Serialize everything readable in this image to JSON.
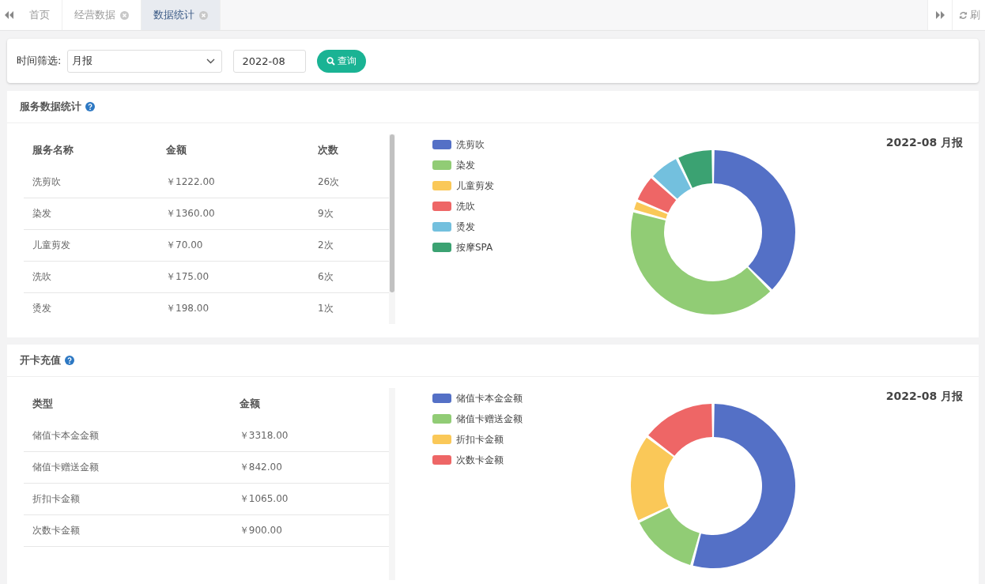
{
  "tabs": [
    {
      "label": "首页",
      "closable": false,
      "selected": false
    },
    {
      "label": "经营数据",
      "closable": true,
      "selected": false
    },
    {
      "label": "数据统计",
      "closable": true,
      "selected": true
    }
  ],
  "refresh_label": "刷",
  "filter": {
    "label": "时间筛选:",
    "period": "月报",
    "date": "2022-08",
    "button": "查询"
  },
  "panels": [
    {
      "title": "服务数据统计",
      "columns": [
        "服务名称",
        "金额",
        "次数"
      ],
      "scrolled": true,
      "rows": [
        [
          "洗剪吹",
          "￥1222.00",
          "26次"
        ],
        [
          "染发",
          "￥1360.00",
          "9次"
        ],
        [
          "儿童剪发",
          "￥70.00",
          "2次"
        ],
        [
          "洗吹",
          "￥175.00",
          "6次"
        ],
        [
          "烫发",
          "￥198.00",
          "1次"
        ]
      ],
      "chart_title": "2022-08 月报",
      "chart_data": {
        "type": "donut",
        "categories": [
          "洗剪吹",
          "染发",
          "儿童剪发",
          "洗吹",
          "烫发",
          "按摩SPA"
        ],
        "values": [
          37.5,
          41.7,
          2.1,
          5.4,
          6.1,
          7.2
        ],
        "colors": [
          "#5470c6",
          "#91cc75",
          "#fac858",
          "#ee6666",
          "#73c0de",
          "#3ba272"
        ]
      }
    },
    {
      "title": "开卡充值",
      "columns": [
        "类型",
        "金额"
      ],
      "scrolled": false,
      "rows": [
        [
          "储值卡本金金额",
          "￥3318.00"
        ],
        [
          "储值卡赠送金额",
          "￥842.00"
        ],
        [
          "折扣卡金额",
          "￥1065.00"
        ],
        [
          "次数卡金额",
          "￥900.00"
        ]
      ],
      "chart_title": "2022-08 月报",
      "chart_data": {
        "type": "donut",
        "categories": [
          "储值卡本金金额",
          "储值卡赠送金额",
          "折扣卡金额",
          "次数卡金额"
        ],
        "values": [
          54.2,
          13.7,
          17.4,
          14.7
        ],
        "colors": [
          "#5470c6",
          "#91cc75",
          "#fac858",
          "#ee6666"
        ]
      }
    }
  ]
}
